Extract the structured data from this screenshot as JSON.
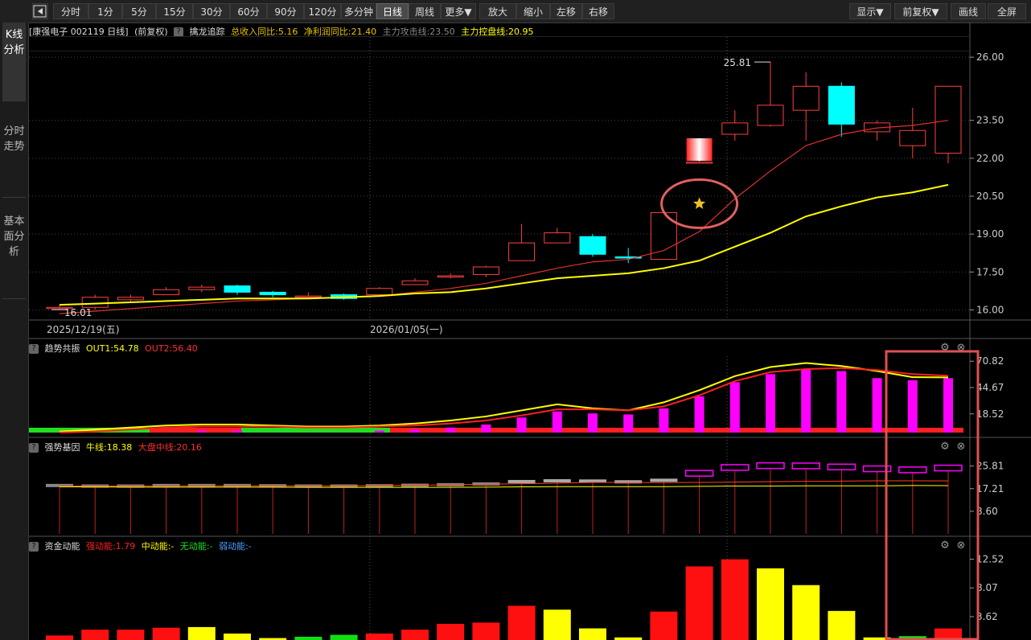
{
  "toolbar": {
    "back_icon": "collapse-left-icon",
    "buttons": [
      "分时",
      "1分",
      "5分",
      "15分",
      "30分",
      "60分",
      "90分",
      "120分",
      "多分钟",
      "日线",
      "周线",
      "更多▼",
      "放大",
      "缩小",
      "左移",
      "右移"
    ],
    "active": "日线",
    "right_buttons": [
      "显示▼",
      "前复权▼",
      "画线",
      "全屏"
    ]
  },
  "side_tabs": [
    "K线分析",
    "分时走势",
    "基本面分析"
  ],
  "main": {
    "title": "[康强电子 002119 日线]",
    "adjust": "(前复权)",
    "indicator": "擒龙追踪",
    "items": [
      {
        "label": "总收入同比:5.16",
        "color": "#e6c200"
      },
      {
        "label": "净利润同比:21.40",
        "color": "#e6c200"
      },
      {
        "label": "主力攻击线:23.50",
        "color": "#888888"
      },
      {
        "label": "主力控盘线:20.95",
        "color": "#ffff00"
      }
    ],
    "y_ticks": [
      "26.00",
      "23.50",
      "22.00",
      "20.50",
      "19.00",
      "17.50",
      "16.00"
    ],
    "high_label": "25.81",
    "low_label": "16.01",
    "dates": [
      "2025/12/19(五)",
      "2026/01/05(一)"
    ]
  },
  "panel1": {
    "name": "趋势共振",
    "out1": "OUT1:54.78",
    "out2": "OUT2:56.40",
    "y_ticks": [
      "70.82",
      "44.67",
      "18.52"
    ]
  },
  "panel2": {
    "name": "强势基因",
    "niu": "牛线:18.38",
    "dapan": "大盘中线:20.16",
    "y_ticks": [
      "25.81",
      "17.21",
      "8.60"
    ]
  },
  "panel3": {
    "name": "资金动能",
    "strong": "强动能:1.79",
    "mid": "中动能:-",
    "none": "无动能:-",
    "weak": "弱动能:-",
    "y_ticks": [
      "12.52",
      "8.07",
      "3.62"
    ]
  },
  "icons": {
    "help": "help-icon",
    "settings": "gear-icon",
    "close": "close-icon",
    "star": "star-icon"
  },
  "chart_data": [
    {
      "type": "candlestick",
      "title": "康强电子 002119 日线",
      "ylim": [
        15.6,
        26.8
      ],
      "candles": [
        [
          16.1,
          16.1,
          16.2,
          16.0
        ],
        [
          16.1,
          16.5,
          16.6,
          16.0
        ],
        [
          16.4,
          16.5,
          16.6,
          16.3
        ],
        [
          16.6,
          16.8,
          16.9,
          16.6
        ],
        [
          16.8,
          16.9,
          17.0,
          16.7
        ],
        [
          16.95,
          16.7,
          17.0,
          16.6
        ],
        [
          16.7,
          16.6,
          16.75,
          16.5
        ],
        [
          16.55,
          16.55,
          16.7,
          16.5
        ],
        [
          16.6,
          16.45,
          16.65,
          16.4
        ],
        [
          16.6,
          16.85,
          16.9,
          16.6
        ],
        [
          17.0,
          17.15,
          17.25,
          17.0
        ],
        [
          17.3,
          17.35,
          17.45,
          17.25
        ],
        [
          17.4,
          17.7,
          17.75,
          17.3
        ],
        [
          17.95,
          18.65,
          19.4,
          17.95
        ],
        [
          18.65,
          19.05,
          19.25,
          18.65
        ],
        [
          18.9,
          18.2,
          19.0,
          18.1
        ],
        [
          18.1,
          18.05,
          18.45,
          17.85
        ],
        [
          18.0,
          19.85,
          19.85,
          18.0
        ],
        [
          21.85,
          21.85,
          22.15,
          21.85
        ],
        [
          22.95,
          23.4,
          23.9,
          22.7
        ],
        [
          23.3,
          24.1,
          25.81,
          23.25
        ],
        [
          23.9,
          24.85,
          25.4,
          22.7
        ],
        [
          24.85,
          23.35,
          25.0,
          22.85
        ],
        [
          23.05,
          23.4,
          23.5,
          22.7
        ],
        [
          22.5,
          23.1,
          24.0,
          22.0
        ],
        [
          22.2,
          24.85,
          24.85,
          21.8
        ]
      ],
      "lines": [
        {
          "name": "主力攻击线",
          "color": "#e03030",
          "values": [
            15.85,
            15.95,
            16.05,
            16.15,
            16.25,
            16.35,
            16.4,
            16.45,
            16.5,
            16.55,
            16.7,
            16.85,
            17.05,
            17.35,
            17.65,
            17.9,
            18.0,
            18.35,
            19.1,
            20.4,
            21.5,
            22.5,
            22.95,
            23.2,
            23.3,
            23.5
          ]
        },
        {
          "name": "主力控盘线",
          "color": "#ffff00",
          "values": [
            16.2,
            16.25,
            16.3,
            16.35,
            16.4,
            16.45,
            16.45,
            16.45,
            16.5,
            16.55,
            16.65,
            16.7,
            16.85,
            17.05,
            17.25,
            17.35,
            17.45,
            17.65,
            17.95,
            18.5,
            19.05,
            19.7,
            20.1,
            20.45,
            20.65,
            20.95
          ]
        }
      ],
      "annotations": [
        {
          "label": "25.81",
          "type": "high"
        },
        {
          "label": "16.01",
          "type": "low"
        }
      ]
    },
    {
      "type": "bar",
      "title": "趋势共振",
      "ylim": [
        0,
        75
      ],
      "values": [
        1,
        1,
        1,
        1,
        2,
        2,
        1,
        1,
        1,
        2,
        3,
        5,
        8,
        15,
        21,
        19,
        18,
        24,
        36,
        50,
        58,
        63,
        61,
        54,
        52,
        54
      ],
      "series": [
        {
          "name": "OUT1",
          "color": "#ffff00",
          "values": [
            1,
            3,
            5,
            7,
            8,
            8,
            7,
            6,
            6,
            7,
            9,
            12,
            16,
            22,
            28,
            24,
            22,
            30,
            42,
            56,
            65,
            69,
            66,
            61,
            55,
            54.78
          ]
        },
        {
          "name": "OUT2",
          "color": "#ff2020",
          "values": [
            0,
            1,
            3,
            5,
            6,
            6,
            6,
            5,
            5,
            6,
            7,
            9,
            12,
            17,
            23,
            23,
            22,
            26,
            37,
            51,
            60,
            63,
            64,
            62,
            58,
            56.4
          ]
        }
      ]
    },
    {
      "type": "bar",
      "title": "强势基因",
      "ylim": [
        0,
        30
      ],
      "values": [
        17.8,
        17.6,
        17.6,
        17.8,
        17.8,
        17.8,
        17.7,
        17.6,
        17.6,
        17.7,
        17.9,
        18.1,
        18.4,
        19.3,
        19.6,
        19.5,
        19.2,
        19.8,
        22.0,
        24.2,
        24.9,
        24.8,
        24.4,
        23.7,
        23.3,
        24.0
      ],
      "series": [
        {
          "name": "牛线",
          "color": "#ffff00",
          "values": [
            17.9,
            17.9,
            17.8,
            17.8,
            17.8,
            17.8,
            17.8,
            17.7,
            17.7,
            17.7,
            17.7,
            17.7,
            17.8,
            17.9,
            18.0,
            18.0,
            18.0,
            18.0,
            18.1,
            18.2,
            18.2,
            18.3,
            18.3,
            18.3,
            18.4,
            18.38
          ]
        },
        {
          "name": "大盘中线",
          "color": "#ff4020",
          "values": [
            18.2,
            18.2,
            18.2,
            18.2,
            18.3,
            18.3,
            18.3,
            18.3,
            18.3,
            18.4,
            18.5,
            18.7,
            18.9,
            19.1,
            19.3,
            19.6,
            19.6,
            19.5,
            19.6,
            19.7,
            19.9,
            20.0,
            20.1,
            20.2,
            20.2,
            20.16
          ]
        }
      ]
    },
    {
      "type": "bar",
      "title": "资金动能",
      "ylim": [
        0,
        13.2
      ],
      "values": [
        0.7,
        1.6,
        1.6,
        1.9,
        2.0,
        1.0,
        0.3,
        0.5,
        0.8,
        1.0,
        1.6,
        2.5,
        2.7,
        5.3,
        4.7,
        1.8,
        0.4,
        4.4,
        11.4,
        12.5,
        11.1,
        8.5,
        4.5,
        0.4,
        0.6,
        1.79
      ],
      "colors": [
        "red",
        "red",
        "red",
        "red",
        "yellow",
        "yellow",
        "yellow",
        "green",
        "green",
        "red",
        "red",
        "red",
        "red",
        "red",
        "yellow",
        "yellow",
        "yellow",
        "red",
        "red",
        "red",
        "yellow",
        "yellow",
        "yellow",
        "yellow",
        "green",
        "red"
      ]
    }
  ]
}
